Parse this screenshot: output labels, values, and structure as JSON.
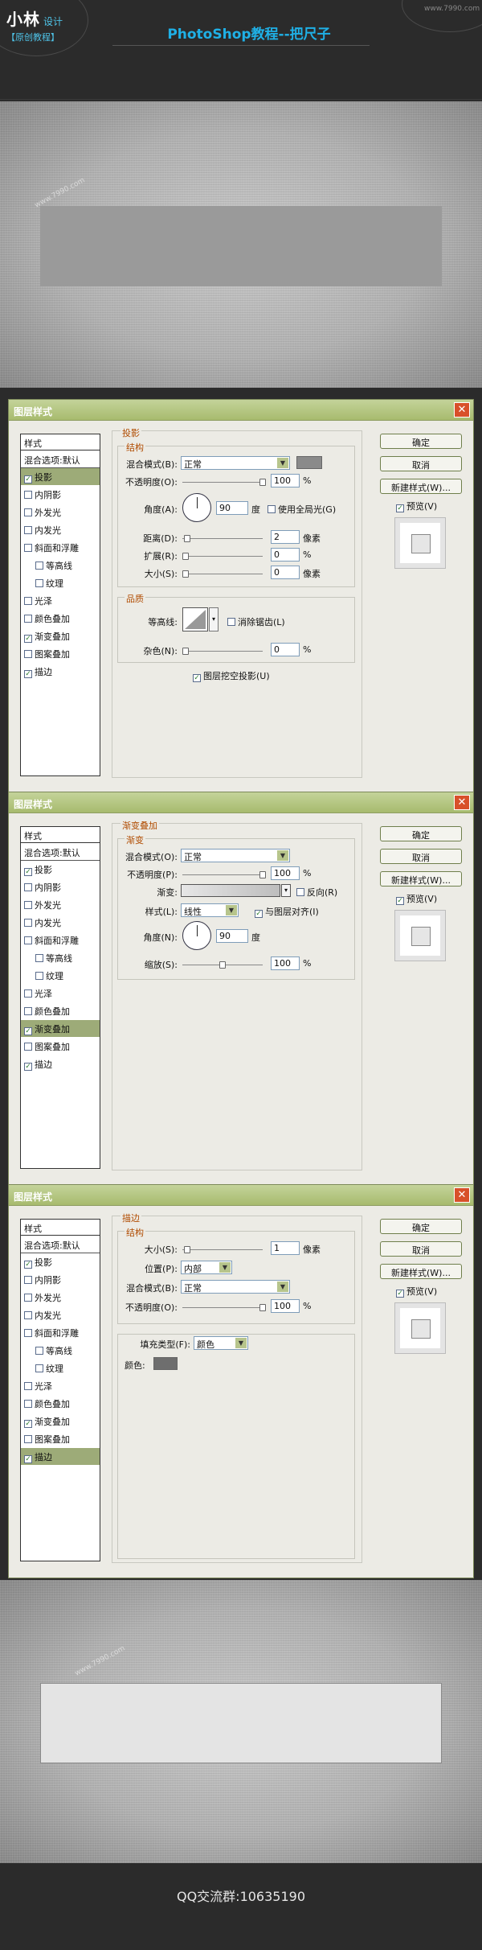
{
  "header": {
    "logo_main": "小林",
    "logo_sub": "设计",
    "logo_tag": "【原创教程】",
    "title": "PhotoShop教程--把尺子",
    "site": "www.7990.com"
  },
  "watermark": "www.7990.com",
  "dialog": {
    "title": "图层样式",
    "close": "✕",
    "left_header": "样式",
    "items": [
      "混合选项:默认",
      "投影",
      "内阴影",
      "外发光",
      "内发光",
      "斜面和浮雕",
      "等高线",
      "纹理",
      "光泽",
      "颜色叠加",
      "渐变叠加",
      "图案叠加",
      "描边"
    ],
    "buttons": {
      "ok": "确定",
      "cancel": "取消",
      "new_style": "新建样式(W)...",
      "preview": "预览(V)"
    }
  },
  "d1": {
    "section": "投影",
    "struct": "结构",
    "blend_label": "混合模式(B):",
    "blend_value": "正常",
    "opacity_label": "不透明度(O):",
    "opacity": "100",
    "pct": "%",
    "angle_label": "角度(A):",
    "angle": "90",
    "deg": "度",
    "global_light": "使用全局光(G)",
    "distance_label": "距离(D):",
    "distance": "2",
    "px": "像素",
    "spread_label": "扩展(R):",
    "spread": "0",
    "size_label": "大小(S):",
    "size": "0",
    "quality": "品质",
    "contour_label": "等高线:",
    "antialias": "消除锯齿(L)",
    "noise_label": "杂色(N):",
    "noise": "0",
    "knockout": "图层挖空投影(U)"
  },
  "d2": {
    "section": "渐变叠加",
    "grad": "渐变",
    "blend_label": "混合模式(O):",
    "blend_value": "正常",
    "opacity_label": "不透明度(P):",
    "opacity": "100",
    "pct": "%",
    "gradient_label": "渐变:",
    "reverse": "反向(R)",
    "style_label": "样式(L):",
    "style_value": "线性",
    "align": "与图层对齐(I)",
    "angle_label": "角度(N):",
    "angle": "90",
    "deg": "度",
    "scale_label": "缩放(S):",
    "scale": "100"
  },
  "d3": {
    "section": "描边",
    "struct": "结构",
    "size_label": "大小(S):",
    "size": "1",
    "px": "像素",
    "position_label": "位置(P):",
    "position_value": "内部",
    "blend_label": "混合模式(B):",
    "blend_value": "正常",
    "opacity_label": "不透明度(O):",
    "opacity": "100",
    "pct": "%",
    "fill_label": "填充类型(F):",
    "fill_value": "颜色",
    "color_label": "颜色:"
  },
  "footer": {
    "qq": "QQ交流群:10635190"
  },
  "colors": {
    "dialog_title": "#a7bb6e",
    "highlight": "#9dab78",
    "shadow_swatch": "#8a8a8a",
    "stroke_swatch": "#6e6e6e",
    "section_title": "#b04b00"
  }
}
